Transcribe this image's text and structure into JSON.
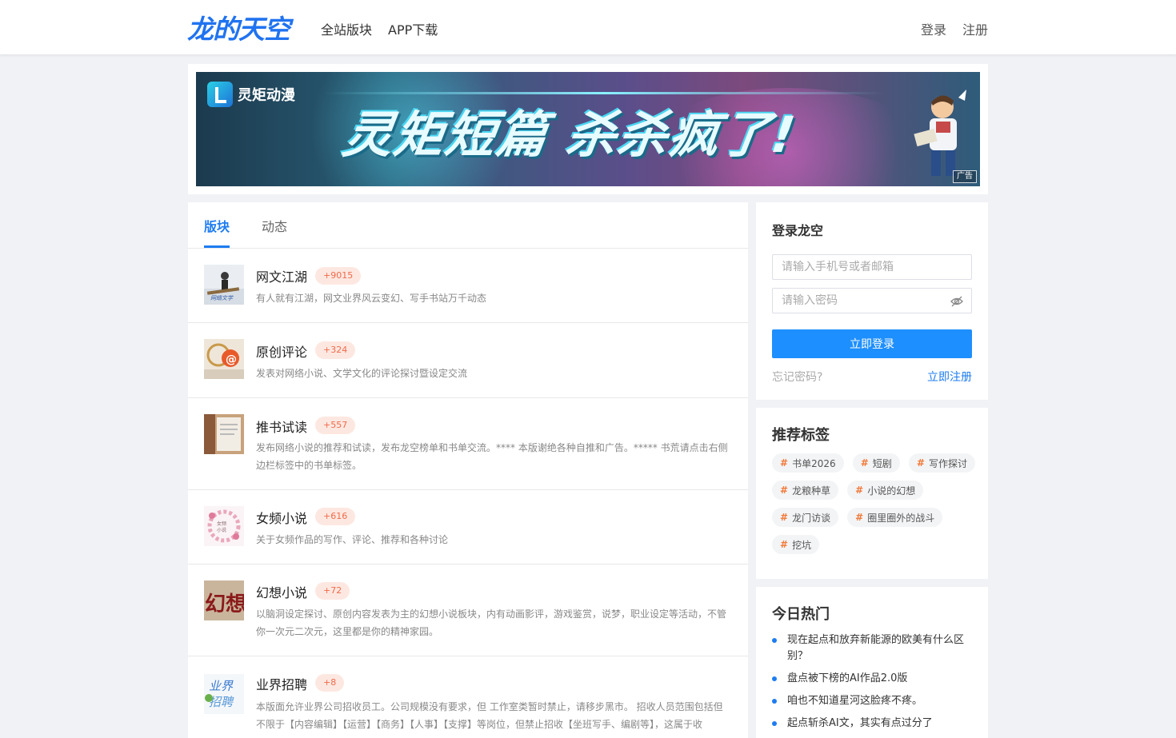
{
  "header": {
    "logo": "龙的天空",
    "nav": [
      "全站版块",
      "APP下载"
    ],
    "login": "登录",
    "register": "注册"
  },
  "banner": {
    "brand": "灵矩动漫",
    "slogan": "灵矩短篇 杀杀疯了!",
    "ad_label": "广告"
  },
  "tabs": [
    "版块",
    "动态"
  ],
  "boards": [
    {
      "name": "网文江湖",
      "count": "+9015",
      "desc": "有人就有江湖，网文业界风云变幻、写手书站万千动态"
    },
    {
      "name": "原创评论",
      "count": "+324",
      "desc": "发表对网络小说、文学文化的评论探讨暨设定交流"
    },
    {
      "name": "推书试读",
      "count": "+557",
      "desc": "发布网络小说的推荐和试读，发布龙空榜单和书单交流。**** 本版谢绝各种自推和广告。***** 书荒请点击右侧边栏标签中的书单标签。"
    },
    {
      "name": "女频小说",
      "count": "+616",
      "desc": "关于女频作品的写作、评论、推荐和各种讨论"
    },
    {
      "name": "幻想小说",
      "count": "+72",
      "desc": "以脑洞设定探讨、原创内容发表为主的幻想小说板块，内有动画影评，游戏鉴赏，说梦，职业设定等活动，不管你一次元二次元，这里都是你的精神家园。"
    },
    {
      "name": "业界招聘",
      "count": "+8",
      "desc": "本版面允许业界公司招收员工。公司规模没有要求，但 工作室类暂时禁止，请移步黑市。 招收人员范围包括但不限于【内容编辑】【运营】【商务】【人事】【支撑】等岗位，但禁止招收【坐班写手、编剧等】，这属于收"
    }
  ],
  "login_card": {
    "title": "登录龙空",
    "account_placeholder": "请输入手机号或者邮箱",
    "password_placeholder": "请输入密码",
    "submit": "立即登录",
    "forgot": "忘记密码?",
    "register": "立即注册"
  },
  "tags_card": {
    "title": "推荐标签",
    "tags": [
      "书单2026",
      "短剧",
      "写作探讨",
      "龙粮种草",
      "小说的幻想",
      "龙门访谈",
      "圈里圈外的战斗",
      "挖坑"
    ]
  },
  "hot_card": {
    "title": "今日热门",
    "items": [
      "现在起点和放弃新能源的欧美有什么区别？",
      "盘点被下榜的AI作品2.0版",
      "咱也不知道星河这脸疼不疼。",
      "起点斩杀AI文，其实有点过分了"
    ]
  },
  "colors": {
    "accent": "#1e7cf0",
    "button": "#1e8fff",
    "badge_bg": "#fde8e1",
    "badge_text": "#f06a4a",
    "tag_hash": "#f07a3a"
  }
}
